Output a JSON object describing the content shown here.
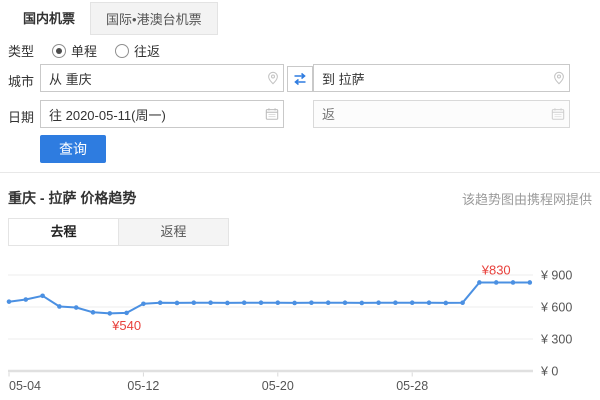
{
  "top_tabs": {
    "domestic": "国内机票",
    "international": "国际•港澳台机票"
  },
  "form": {
    "type_label": "类型",
    "oneway_label": "单程",
    "roundtrip_label": "往返",
    "city_label": "城市",
    "from_value": "从 重庆",
    "to_value": "到 拉萨",
    "date_label": "日期",
    "depart_value": "往 2020-05-11(周一)",
    "return_placeholder": "返",
    "search_label": "查询"
  },
  "trend": {
    "title": "重庆 - 拉萨 价格趋势",
    "source_note": "该趋势图由携程网提供",
    "tab_outbound": "去程",
    "tab_return": "返程"
  },
  "colors": {
    "accent": "#2e7ce0",
    "line": "#4b90e2",
    "annotation": "#e8413c",
    "grid": "#ececec",
    "axis": "#e0e0e0",
    "tick_text": "#555"
  },
  "chart_data": {
    "type": "line",
    "title": "重庆 - 拉萨 价格趋势",
    "x": [
      "05-04",
      "05-05",
      "05-06",
      "05-07",
      "05-08",
      "05-09",
      "05-10",
      "05-11",
      "05-12",
      "05-13",
      "05-14",
      "05-15",
      "05-16",
      "05-17",
      "05-18",
      "05-19",
      "05-20",
      "05-21",
      "05-22",
      "05-23",
      "05-24",
      "05-25",
      "05-26",
      "05-27",
      "05-28",
      "05-29",
      "05-30",
      "05-31",
      "06-01",
      "06-02",
      "06-03",
      "06-04"
    ],
    "values": [
      650,
      670,
      705,
      605,
      595,
      550,
      540,
      545,
      630,
      640,
      638,
      640,
      640,
      638,
      640,
      640,
      640,
      638,
      640,
      640,
      640,
      638,
      640,
      640,
      640,
      640,
      638,
      640,
      830,
      830,
      830,
      830
    ],
    "ylim": [
      0,
      1100
    ],
    "y_ticks": [
      900,
      600,
      300,
      0
    ],
    "y_tick_labels": [
      "¥ 900",
      "¥ 600",
      "¥ 300",
      "¥ 0"
    ],
    "y_axis_side": "right",
    "x_tick_labels": [
      "05-04",
      "05-12",
      "05-20",
      "05-28"
    ],
    "x_tick_indices": [
      0,
      8,
      16,
      24
    ],
    "grid": "horizontal",
    "annotations": [
      {
        "text": "¥540",
        "x_index": 7,
        "position": "below"
      },
      {
        "text": "¥830",
        "x_index": 29,
        "position": "above"
      }
    ]
  }
}
